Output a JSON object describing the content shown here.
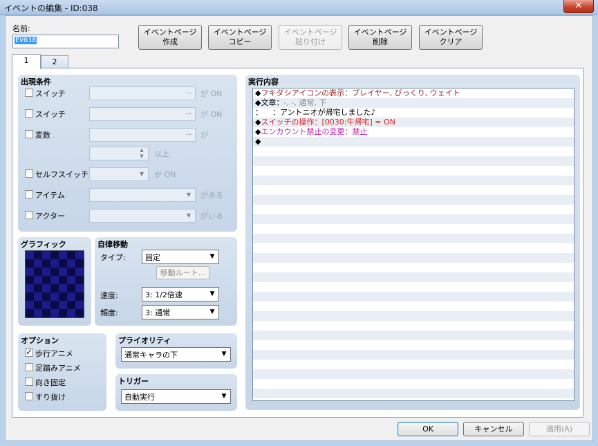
{
  "window": {
    "title": "イベントの編集 - ID:038",
    "close": "✕"
  },
  "name": {
    "label": "名前:",
    "value": "EV038"
  },
  "top_buttons": [
    {
      "line1": "イベントページ",
      "line2": "作成",
      "enabled": true
    },
    {
      "line1": "イベントページ",
      "line2": "コピー",
      "enabled": true
    },
    {
      "line1": "イベントページ",
      "line2": "貼り付け",
      "enabled": false
    },
    {
      "line1": "イベントページ",
      "line2": "削除",
      "enabled": true
    },
    {
      "line1": "イベントページ",
      "line2": "クリア",
      "enabled": true
    }
  ],
  "tabs": [
    {
      "label": "1",
      "active": true
    },
    {
      "label": "2",
      "active": false
    }
  ],
  "conditions": {
    "title": "出現条件",
    "switch1": {
      "label": "スイッチ",
      "value": "",
      "button": "...",
      "suffix": "が ON"
    },
    "switch2": {
      "label": "スイッチ",
      "value": "",
      "button": "...",
      "suffix": "が ON"
    },
    "variable": {
      "label": "変数",
      "value": "",
      "button": "...",
      "suffix": "が",
      "num_suffix": "以上"
    },
    "self_switch": {
      "label": "セルフスイッチ",
      "suffix": "が ON"
    },
    "item": {
      "label": "アイテム",
      "suffix": "がある"
    },
    "actor": {
      "label": "アクター",
      "suffix": "がいる"
    }
  },
  "graphic": {
    "title": "グラフィック"
  },
  "movement": {
    "title": "自律移動",
    "type_label": "タイプ:",
    "type_value": "固定",
    "route_button": "移動ルート...",
    "speed_label": "速度:",
    "speed_value": "3: 1/2倍速",
    "freq_label": "頻度:",
    "freq_value": "3: 通常"
  },
  "options": {
    "title": "オプション",
    "items": [
      {
        "label": "歩行アニメ",
        "checked": true
      },
      {
        "label": "足踏みアニメ",
        "checked": false
      },
      {
        "label": "向き固定",
        "checked": false
      },
      {
        "label": "すり抜け",
        "checked": false
      }
    ]
  },
  "priority": {
    "title": "プライオリティ",
    "value": "通常キャラの下"
  },
  "trigger": {
    "title": "トリガー",
    "value": "自動実行"
  },
  "contents": {
    "title": "実行内容",
    "lines": [
      {
        "marker": "◆",
        "text": "フキダシアイコンの表示：プレイヤー, びっくり, ウェイト",
        "color": "#9b1c1c"
      },
      {
        "marker": "◆",
        "text": "文章：",
        "extra": "-, -, 通常, 下",
        "color": "#000000",
        "extra_color": "#8c8c8c"
      },
      {
        "marker": "：",
        "text": "    ：アントニオが帰宅しました♪",
        "color": "#000000"
      },
      {
        "marker": "◆",
        "text": "スイッチの操作：[0030:牛帰宅] = ON",
        "color": "#e01e1e"
      },
      {
        "marker": "◆",
        "text": "エンカウント禁止の変更：禁止",
        "color": "#c81eaa"
      },
      {
        "marker": "◆",
        "text": "",
        "color": "#000000"
      }
    ]
  },
  "bottom_buttons": {
    "ok": "OK",
    "cancel": "キャンセル",
    "apply": "適用(A)"
  }
}
